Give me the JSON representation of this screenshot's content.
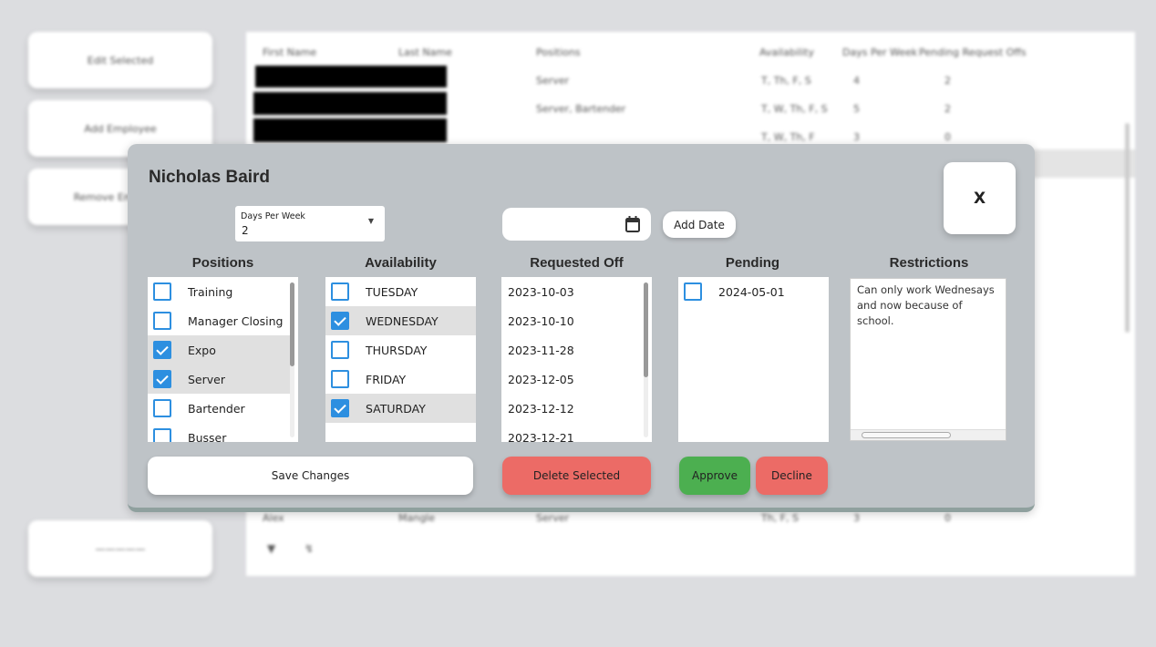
{
  "sidebar": {
    "edit_selected": "Edit Selected",
    "add_employee": "Add Employee",
    "remove_employee": "Remove Employee",
    "bottom_button": "—————"
  },
  "table": {
    "headers": [
      "First Name",
      "Last Name",
      "Positions",
      "Availability",
      "Days Per Week",
      "Pending Request Offs"
    ],
    "rows": [
      {
        "positions": "Server",
        "availability": "T, Th, F, S",
        "days": "4",
        "pending": "2"
      },
      {
        "positions": "Server, Bartender",
        "availability": "T, W, Th, F, S",
        "days": "5",
        "pending": "2"
      },
      {
        "positions": "",
        "availability": "T, W, Th, F",
        "days": "3",
        "pending": "0"
      }
    ],
    "last_row": {
      "first": "Alex",
      "last": "Mangle",
      "positions": "Server",
      "availability": "Th, F, S",
      "days": "3",
      "pending": "0"
    }
  },
  "modal": {
    "title": "Nicholas Baird",
    "close_label": "X",
    "days_per_week": {
      "label": "Days Per Week",
      "value": "2"
    },
    "date_input": {
      "value": "",
      "icon": "calendar-icon"
    },
    "add_date_label": "Add Date",
    "positions": {
      "header": "Positions",
      "items": [
        {
          "label": "Training",
          "checked": false
        },
        {
          "label": "Manager Closing",
          "checked": false
        },
        {
          "label": "Expo",
          "checked": true
        },
        {
          "label": "Server",
          "checked": true
        },
        {
          "label": "Bartender",
          "checked": false
        },
        {
          "label": "Busser",
          "checked": false
        }
      ]
    },
    "availability": {
      "header": "Availability",
      "items": [
        {
          "label": "TUESDAY",
          "checked": false
        },
        {
          "label": "WEDNESDAY",
          "checked": true
        },
        {
          "label": "THURSDAY",
          "checked": false
        },
        {
          "label": "FRIDAY",
          "checked": false
        },
        {
          "label": "SATURDAY",
          "checked": true
        }
      ]
    },
    "requested_off": {
      "header": "Requested Off",
      "items": [
        "2023-10-03",
        "2023-10-10",
        "2023-11-28",
        "2023-12-05",
        "2023-12-12",
        "2023-12-21"
      ]
    },
    "pending": {
      "header": "Pending",
      "items": [
        {
          "label": "2024-05-01",
          "checked": false
        }
      ]
    },
    "restrictions": {
      "header": "Restrictions",
      "text": "Can only work Wednesays and now because of school."
    },
    "save_label": "Save Changes",
    "delete_label": "Delete Selected",
    "approve_label": "Approve",
    "decline_label": "Decline",
    "colors": {
      "accent": "#2d8fe0",
      "danger": "#ec6b66",
      "success": "#4caf50"
    }
  }
}
